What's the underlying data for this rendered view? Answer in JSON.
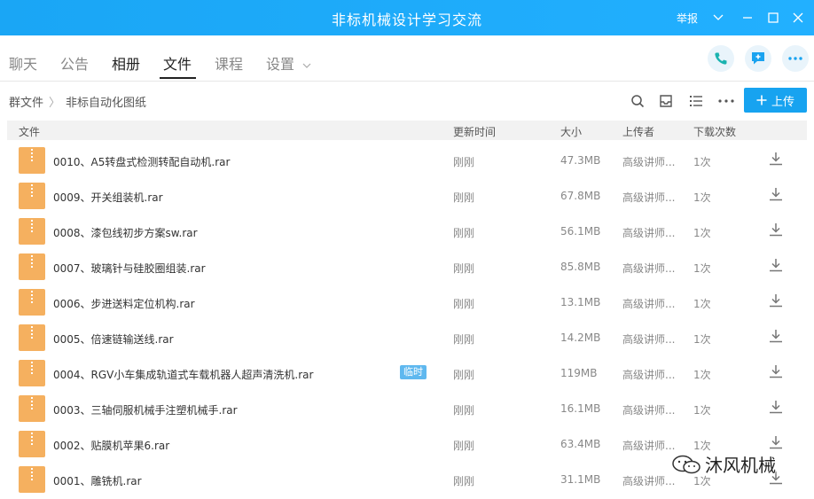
{
  "window": {
    "title": "非标机械设计学习交流",
    "report_label": "举报"
  },
  "tabs": [
    {
      "label": "聊天",
      "active": false
    },
    {
      "label": "公告",
      "active": false
    },
    {
      "label": "相册",
      "active": false
    },
    {
      "label": "文件",
      "active": true
    },
    {
      "label": "课程",
      "active": false
    },
    {
      "label": "设置",
      "active": false
    }
  ],
  "icons": {
    "phone": "phone-icon",
    "add": "add-member-icon",
    "more": "more-icon"
  },
  "breadcrumb": {
    "root": "群文件",
    "current": "非标自动化图纸"
  },
  "toolbar": {
    "upload_label": "上传"
  },
  "table": {
    "headers": {
      "file": "文件",
      "time": "更新时间",
      "size": "大小",
      "uploader": "上传者",
      "downloads": "下载次数"
    },
    "rows": [
      {
        "name": "0010、A5转盘式检测转配自动机.rar",
        "tag": "",
        "time": "刚刚",
        "size": "47.3MB",
        "uploader": "高级讲师...",
        "downloads": "1次"
      },
      {
        "name": "0009、开关组装机.rar",
        "tag": "",
        "time": "刚刚",
        "size": "67.8MB",
        "uploader": "高级讲师...",
        "downloads": "1次"
      },
      {
        "name": "0008、漆包线初步方案sw.rar",
        "tag": "",
        "time": "刚刚",
        "size": "56.1MB",
        "uploader": "高级讲师...",
        "downloads": "1次"
      },
      {
        "name": "0007、玻璃针与硅胶圈组装.rar",
        "tag": "",
        "time": "刚刚",
        "size": "85.8MB",
        "uploader": "高级讲师...",
        "downloads": "1次"
      },
      {
        "name": "0006、步进送料定位机构.rar",
        "tag": "",
        "time": "刚刚",
        "size": "13.1MB",
        "uploader": "高级讲师...",
        "downloads": "1次"
      },
      {
        "name": "0005、倍速链输送线.rar",
        "tag": "",
        "time": "刚刚",
        "size": "14.2MB",
        "uploader": "高级讲师...",
        "downloads": "1次"
      },
      {
        "name": "0004、RGV小车集成轨道式车载机器人超声清洗机.rar",
        "tag": "临时",
        "time": "刚刚",
        "size": "119MB",
        "uploader": "高级讲师...",
        "downloads": "1次"
      },
      {
        "name": "0003、三轴伺服机械手注塑机械手.rar",
        "tag": "",
        "time": "刚刚",
        "size": "16.1MB",
        "uploader": "高级讲师...",
        "downloads": "1次"
      },
      {
        "name": "0002、贴膜机苹果6.rar",
        "tag": "",
        "time": "刚刚",
        "size": "63.4MB",
        "uploader": "高级讲师...",
        "downloads": "1次"
      },
      {
        "name": "0001、雕铣机.rar",
        "tag": "",
        "time": "刚刚",
        "size": "31.1MB",
        "uploader": "高级讲师...",
        "downloads": "1次"
      }
    ]
  },
  "watermark": {
    "text": "沐风机械"
  }
}
